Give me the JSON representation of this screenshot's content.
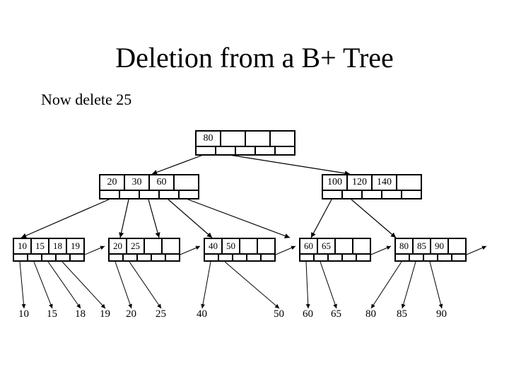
{
  "title": "Deletion from a B+ Tree",
  "subtitle": "Now delete 25",
  "root": {
    "keys": [
      "80",
      "",
      "",
      ""
    ]
  },
  "left_internal": {
    "keys": [
      "20",
      "30",
      "60",
      ""
    ]
  },
  "right_internal": {
    "keys": [
      "100",
      "120",
      "140",
      ""
    ]
  },
  "leaves": [
    {
      "keys": [
        "10",
        "15",
        "18",
        "19"
      ]
    },
    {
      "keys": [
        "20",
        "25",
        "",
        ""
      ]
    },
    {
      "keys": [
        "40",
        "50",
        "",
        ""
      ]
    },
    {
      "keys": [
        "60",
        "65",
        "",
        ""
      ]
    },
    {
      "keys": [
        "80",
        "85",
        "90",
        ""
      ]
    }
  ],
  "data_values": [
    "10",
    "15",
    "18",
    "19",
    "20",
    "25",
    "40",
    "50",
    "60",
    "65",
    "80",
    "85",
    "90"
  ]
}
